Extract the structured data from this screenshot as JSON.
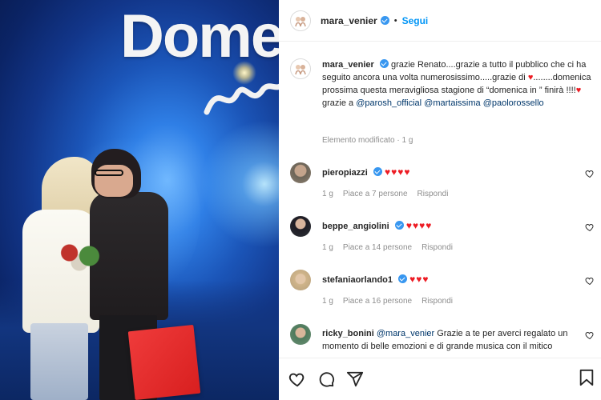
{
  "photo": {
    "logo_text": "Dome"
  },
  "header": {
    "username": "mara_venier",
    "follow_label": "Segui",
    "separator": "•"
  },
  "caption": {
    "username": "mara_venier",
    "text_part1": "grazie Renato....grazie a tutto il pubblico che ci ha seguito ancora una volta numerosissimo.....grazie di",
    "text_part2": "........domenica prossima questa meravigliosa stagione di “domenica in ” finirà !!!!",
    "text_part3": "grazie a",
    "mention1": "@parosh_official",
    "mention2": "@martaissima",
    "mention3": "@paolorossello",
    "edited": "Elemento modificato · 1 g"
  },
  "comments": [
    {
      "username": "pieropiazzi",
      "verified": true,
      "text": "♥♥♥♥",
      "time": "1 g",
      "likes": "Piace a 7 persone",
      "reply": "Rispondi"
    },
    {
      "username": "beppe_angiolini",
      "verified": true,
      "text": "♥♥♥♥",
      "time": "1 g",
      "likes": "Piace a 14 persone",
      "reply": "Rispondi"
    },
    {
      "username": "stefaniaorlando1",
      "verified": true,
      "text": "♥♥♥",
      "time": "1 g",
      "likes": "Piace a 16 persone",
      "reply": "Rispondi"
    },
    {
      "username": "ricky_bonini",
      "verified": false,
      "mention": "@mara_venier",
      "text": "Grazie a te per averci regalato un momento di belle emozioni e di grande musica con il mitico"
    }
  ],
  "icons": {
    "like": "heart-outline-icon",
    "comment": "comment-bubble-icon",
    "share": "paper-plane-icon",
    "save": "bookmark-icon"
  },
  "colors": {
    "link": "#0095f6",
    "mention": "#00376b",
    "heart": "#ed1c24",
    "verified": "#3897f0",
    "muted": "#8e8e8e"
  }
}
